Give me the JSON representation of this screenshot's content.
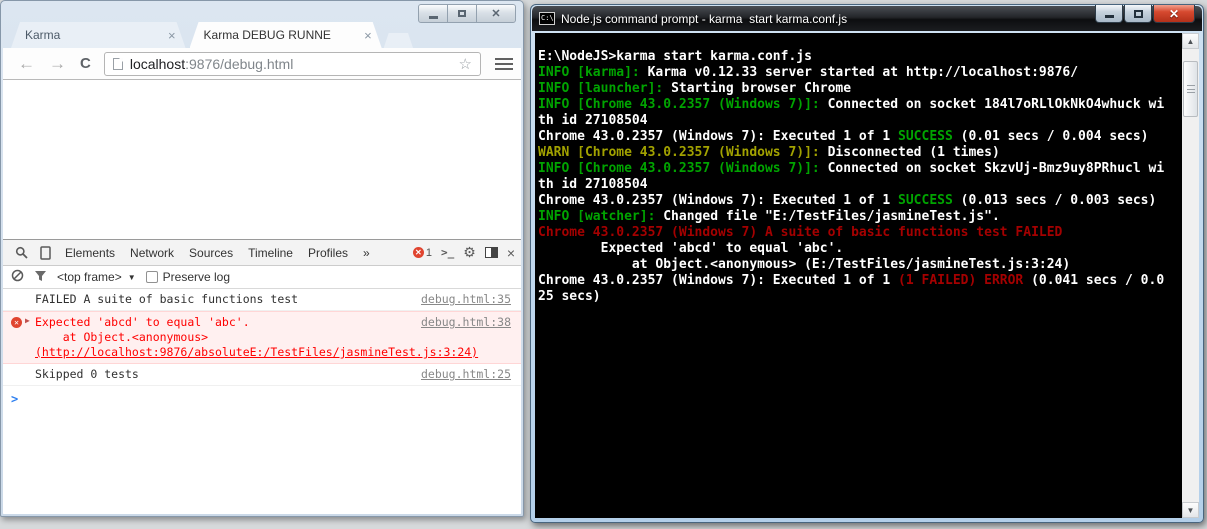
{
  "browser": {
    "tabs": [
      {
        "title": "Karma"
      },
      {
        "title": "Karma DEBUG RUNNE"
      }
    ],
    "address_bar": {
      "url_host": "localhost",
      "url_rest": ":9876/debug.html"
    },
    "devtools": {
      "panel_tabs": [
        "Elements",
        "Network",
        "Sources",
        "Timeline",
        "Profiles",
        "»"
      ],
      "error_count": "1",
      "frame_selector": "<top frame>",
      "preserve_log_label": "Preserve log",
      "console_messages": [
        {
          "kind": "log",
          "lines": [
            "FAILED A suite of basic functions test"
          ],
          "location": "debug.html:35"
        },
        {
          "kind": "error",
          "lines": [
            "Expected 'abcd' to equal 'abc'.",
            "    at Object.<anonymous>",
            "(http://localhost:9876/absoluteE:/TestFiles/jasmineTest.js:3:24)"
          ],
          "underline_line": 2,
          "location": "debug.html:38"
        },
        {
          "kind": "log",
          "lines": [
            "Skipped 0 tests"
          ],
          "location": "debug.html:25"
        }
      ]
    }
  },
  "terminal": {
    "title": "Node.js command prompt - karma  start karma.conf.js",
    "icon_text": "C:\\",
    "colors": {
      "white": "#ffffff",
      "green": "#00a400",
      "yellow": "#a2a200",
      "red": "#a40000"
    },
    "lines": [
      [
        {
          "t": "E:\\NodeJS>karma start karma.conf.js",
          "c": "white"
        }
      ],
      [
        {
          "t": "INFO [karma]: ",
          "c": "green"
        },
        {
          "t": "Karma v0.12.33 server started at http://localhost:9876/",
          "c": "white"
        }
      ],
      [
        {
          "t": "INFO [launcher]: ",
          "c": "green"
        },
        {
          "t": "Starting browser Chrome",
          "c": "white"
        }
      ],
      [
        {
          "t": "INFO [Chrome 43.0.2357 (Windows 7)]: ",
          "c": "green"
        },
        {
          "t": "Connected on socket 184l7oRLlOkNkO4whuck wi",
          "c": "white"
        }
      ],
      [
        {
          "t": "th id 27108504",
          "c": "white"
        }
      ],
      [
        {
          "t": "Chrome 43.0.2357 (Windows 7): Executed 1 of 1 ",
          "c": "white"
        },
        {
          "t": "SUCCESS",
          "c": "green"
        },
        {
          "t": " (0.01 secs / 0.004 secs)",
          "c": "white"
        }
      ],
      [
        {
          "t": "WARN [Chrome 43.0.2357 (Windows 7)]: ",
          "c": "yellow"
        },
        {
          "t": "Disconnected (1 times)",
          "c": "white"
        }
      ],
      [
        {
          "t": "INFO [Chrome 43.0.2357 (Windows 7)]: ",
          "c": "green"
        },
        {
          "t": "Connected on socket SkzvUj-Bmz9uy8PRhucl wi",
          "c": "white"
        }
      ],
      [
        {
          "t": "th id 27108504",
          "c": "white"
        }
      ],
      [
        {
          "t": "Chrome 43.0.2357 (Windows 7): Executed 1 of 1 ",
          "c": "white"
        },
        {
          "t": "SUCCESS",
          "c": "green"
        },
        {
          "t": " (0.013 secs / 0.003 secs)",
          "c": "white"
        }
      ],
      [
        {
          "t": "INFO [watcher]: ",
          "c": "green"
        },
        {
          "t": "Changed file \"E:/TestFiles/jasmineTest.js\".",
          "c": "white"
        }
      ],
      [
        {
          "t": "Chrome 43.0.2357 (Windows 7) A suite of basic functions test FAILED",
          "c": "red"
        }
      ],
      [
        {
          "t": "        Expected 'abcd' to equal 'abc'.",
          "c": "white"
        }
      ],
      [
        {
          "t": "            at Object.<anonymous> (E:/TestFiles/jasmineTest.js:3:24)",
          "c": "white"
        }
      ],
      [
        {
          "t": "Chrome 43.0.2357 (Windows 7): Executed 1 of 1 ",
          "c": "white"
        },
        {
          "t": "(1 FAILED) ERROR",
          "c": "red"
        },
        {
          "t": " (0.041 secs / 0.0",
          "c": "white"
        }
      ],
      [
        {
          "t": "25 secs)",
          "c": "white"
        }
      ]
    ]
  }
}
